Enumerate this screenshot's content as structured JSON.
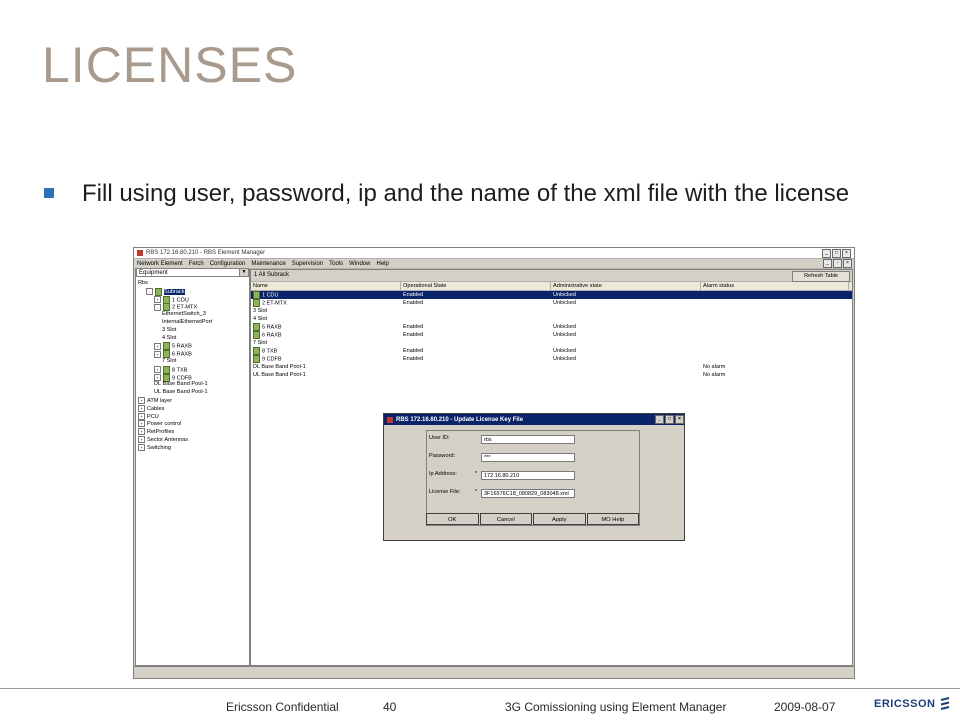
{
  "slide": {
    "title": "LICENSES",
    "bullet": "Fill using user, password, ip and the name of the xml file with the license"
  },
  "window": {
    "title": "RBS 172.16.80.210 - RBS Element Manager",
    "menu": [
      "Network Element",
      "Fetch",
      "Configuration",
      "Maintenance",
      "Supervision",
      "Tools",
      "Window",
      "Help"
    ],
    "left_combo": "Equipment",
    "right_header": "1 All Subrack",
    "refresh_button": "Refresh Table",
    "tree": [
      {
        "label": "Rbs",
        "exp": "",
        "indent": 0,
        "icon": false,
        "sel": false
      },
      {
        "label": "Subrack",
        "exp": "-",
        "indent": 1,
        "icon": true,
        "sel": true
      },
      {
        "label": "1 CDU",
        "exp": "+",
        "indent": 2,
        "icon": true,
        "sel": false
      },
      {
        "label": "2 ET-MTX",
        "exp": "-",
        "indent": 2,
        "icon": true,
        "sel": false
      },
      {
        "label": "EthernetSwitch_3",
        "exp": "",
        "indent": 3,
        "icon": false,
        "sel": false
      },
      {
        "label": "InternalEthernetPort",
        "exp": "",
        "indent": 3,
        "icon": false,
        "sel": false
      },
      {
        "label": "3 Slot",
        "exp": "",
        "indent": 3,
        "icon": false,
        "sel": false
      },
      {
        "label": "4 Slot",
        "exp": "",
        "indent": 3,
        "icon": false,
        "sel": false
      },
      {
        "label": "5 RAXB",
        "exp": "+",
        "indent": 2,
        "icon": true,
        "sel": false
      },
      {
        "label": "6 RAXB",
        "exp": "+",
        "indent": 2,
        "icon": true,
        "sel": false
      },
      {
        "label": "7 Slot",
        "exp": "",
        "indent": 3,
        "icon": false,
        "sel": false
      },
      {
        "label": "8 TXB",
        "exp": "+",
        "indent": 2,
        "icon": true,
        "sel": false
      },
      {
        "label": "9 CDFB",
        "exp": "+",
        "indent": 2,
        "icon": true,
        "sel": false
      },
      {
        "label": "DL Base Band Pool-1",
        "exp": "",
        "indent": 2,
        "icon": false,
        "sel": false
      },
      {
        "label": "UL Base Band Pool-1",
        "exp": "",
        "indent": 2,
        "icon": false,
        "sel": false
      },
      {
        "label": "ATM layer",
        "exp": "+",
        "indent": 0,
        "icon": false,
        "sel": false
      },
      {
        "label": "Cables",
        "exp": "+",
        "indent": 0,
        "icon": false,
        "sel": false
      },
      {
        "label": "PCU",
        "exp": "+",
        "indent": 0,
        "icon": false,
        "sel": false
      },
      {
        "label": "Power control",
        "exp": "+",
        "indent": 0,
        "icon": false,
        "sel": false
      },
      {
        "label": "RetProfiles",
        "exp": "+",
        "indent": 0,
        "icon": false,
        "sel": false
      },
      {
        "label": "Sector Antennas",
        "exp": "+",
        "indent": 0,
        "icon": false,
        "sel": false
      },
      {
        "label": "Switching",
        "exp": "+",
        "indent": 0,
        "icon": false,
        "sel": false
      }
    ],
    "table": {
      "headers": [
        "Name",
        "Operational State",
        "Administrative state",
        "Alarm status"
      ],
      "rows": [
        {
          "name": "1 CDU",
          "op": "Enabled",
          "adm": "Unlocked",
          "alarm": "",
          "icon": true,
          "sel": true
        },
        {
          "name": "2 ET-MTX",
          "op": "Enabled",
          "adm": "Unlocked",
          "alarm": "",
          "icon": true,
          "sel": false
        },
        {
          "name": "3 Slot",
          "op": "",
          "adm": "",
          "alarm": "",
          "icon": false,
          "sel": false
        },
        {
          "name": "4 Slot",
          "op": "",
          "adm": "",
          "alarm": "",
          "icon": false,
          "sel": false
        },
        {
          "name": "5 RAXB",
          "op": "Enabled",
          "adm": "Unlocked",
          "alarm": "",
          "icon": true,
          "sel": false
        },
        {
          "name": "6 RAXB",
          "op": "Enabled",
          "adm": "Unlocked",
          "alarm": "",
          "icon": true,
          "sel": false
        },
        {
          "name": "7 Slot",
          "op": "",
          "adm": "",
          "alarm": "",
          "icon": false,
          "sel": false
        },
        {
          "name": "8 TXB",
          "op": "Enabled",
          "adm": "Unlocked",
          "alarm": "",
          "icon": true,
          "sel": false
        },
        {
          "name": "9 CDFB",
          "op": "Enabled",
          "adm": "Unlocked",
          "alarm": "",
          "icon": true,
          "sel": false
        },
        {
          "name": "DL Base Band Pool-1",
          "op": "",
          "adm": "",
          "alarm": "No alarm",
          "icon": false,
          "sel": false
        },
        {
          "name": "UL Base Band Pool-1",
          "op": "",
          "adm": "",
          "alarm": "No alarm",
          "icon": false,
          "sel": false
        }
      ]
    }
  },
  "dialog": {
    "title": "RBS 172.16.80.210 - Update License Key File",
    "fields": [
      {
        "label": "User ID:",
        "star": "",
        "value": "rbs"
      },
      {
        "label": "Password:",
        "star": "",
        "value": "***"
      },
      {
        "label": "Ip Address:",
        "star": "*",
        "value": "172.16.80.210"
      },
      {
        "label": "License File:",
        "star": "*",
        "value": "3F16576C18_080829_083048.xml"
      }
    ],
    "buttons": [
      "OK",
      "Cancel",
      "Apply",
      "MO Help"
    ]
  },
  "footer": {
    "confidential": "Ericsson Confidential",
    "page": "40",
    "doc_title": "3G Comissioning using Element Manager",
    "date": "2009-08-07",
    "logo_text": "ERICSSON"
  },
  "colors": {
    "title": "#a89a8c",
    "bullet": "#2e73b8",
    "selection": "#0a246a",
    "brand": "#1b3f7a"
  }
}
